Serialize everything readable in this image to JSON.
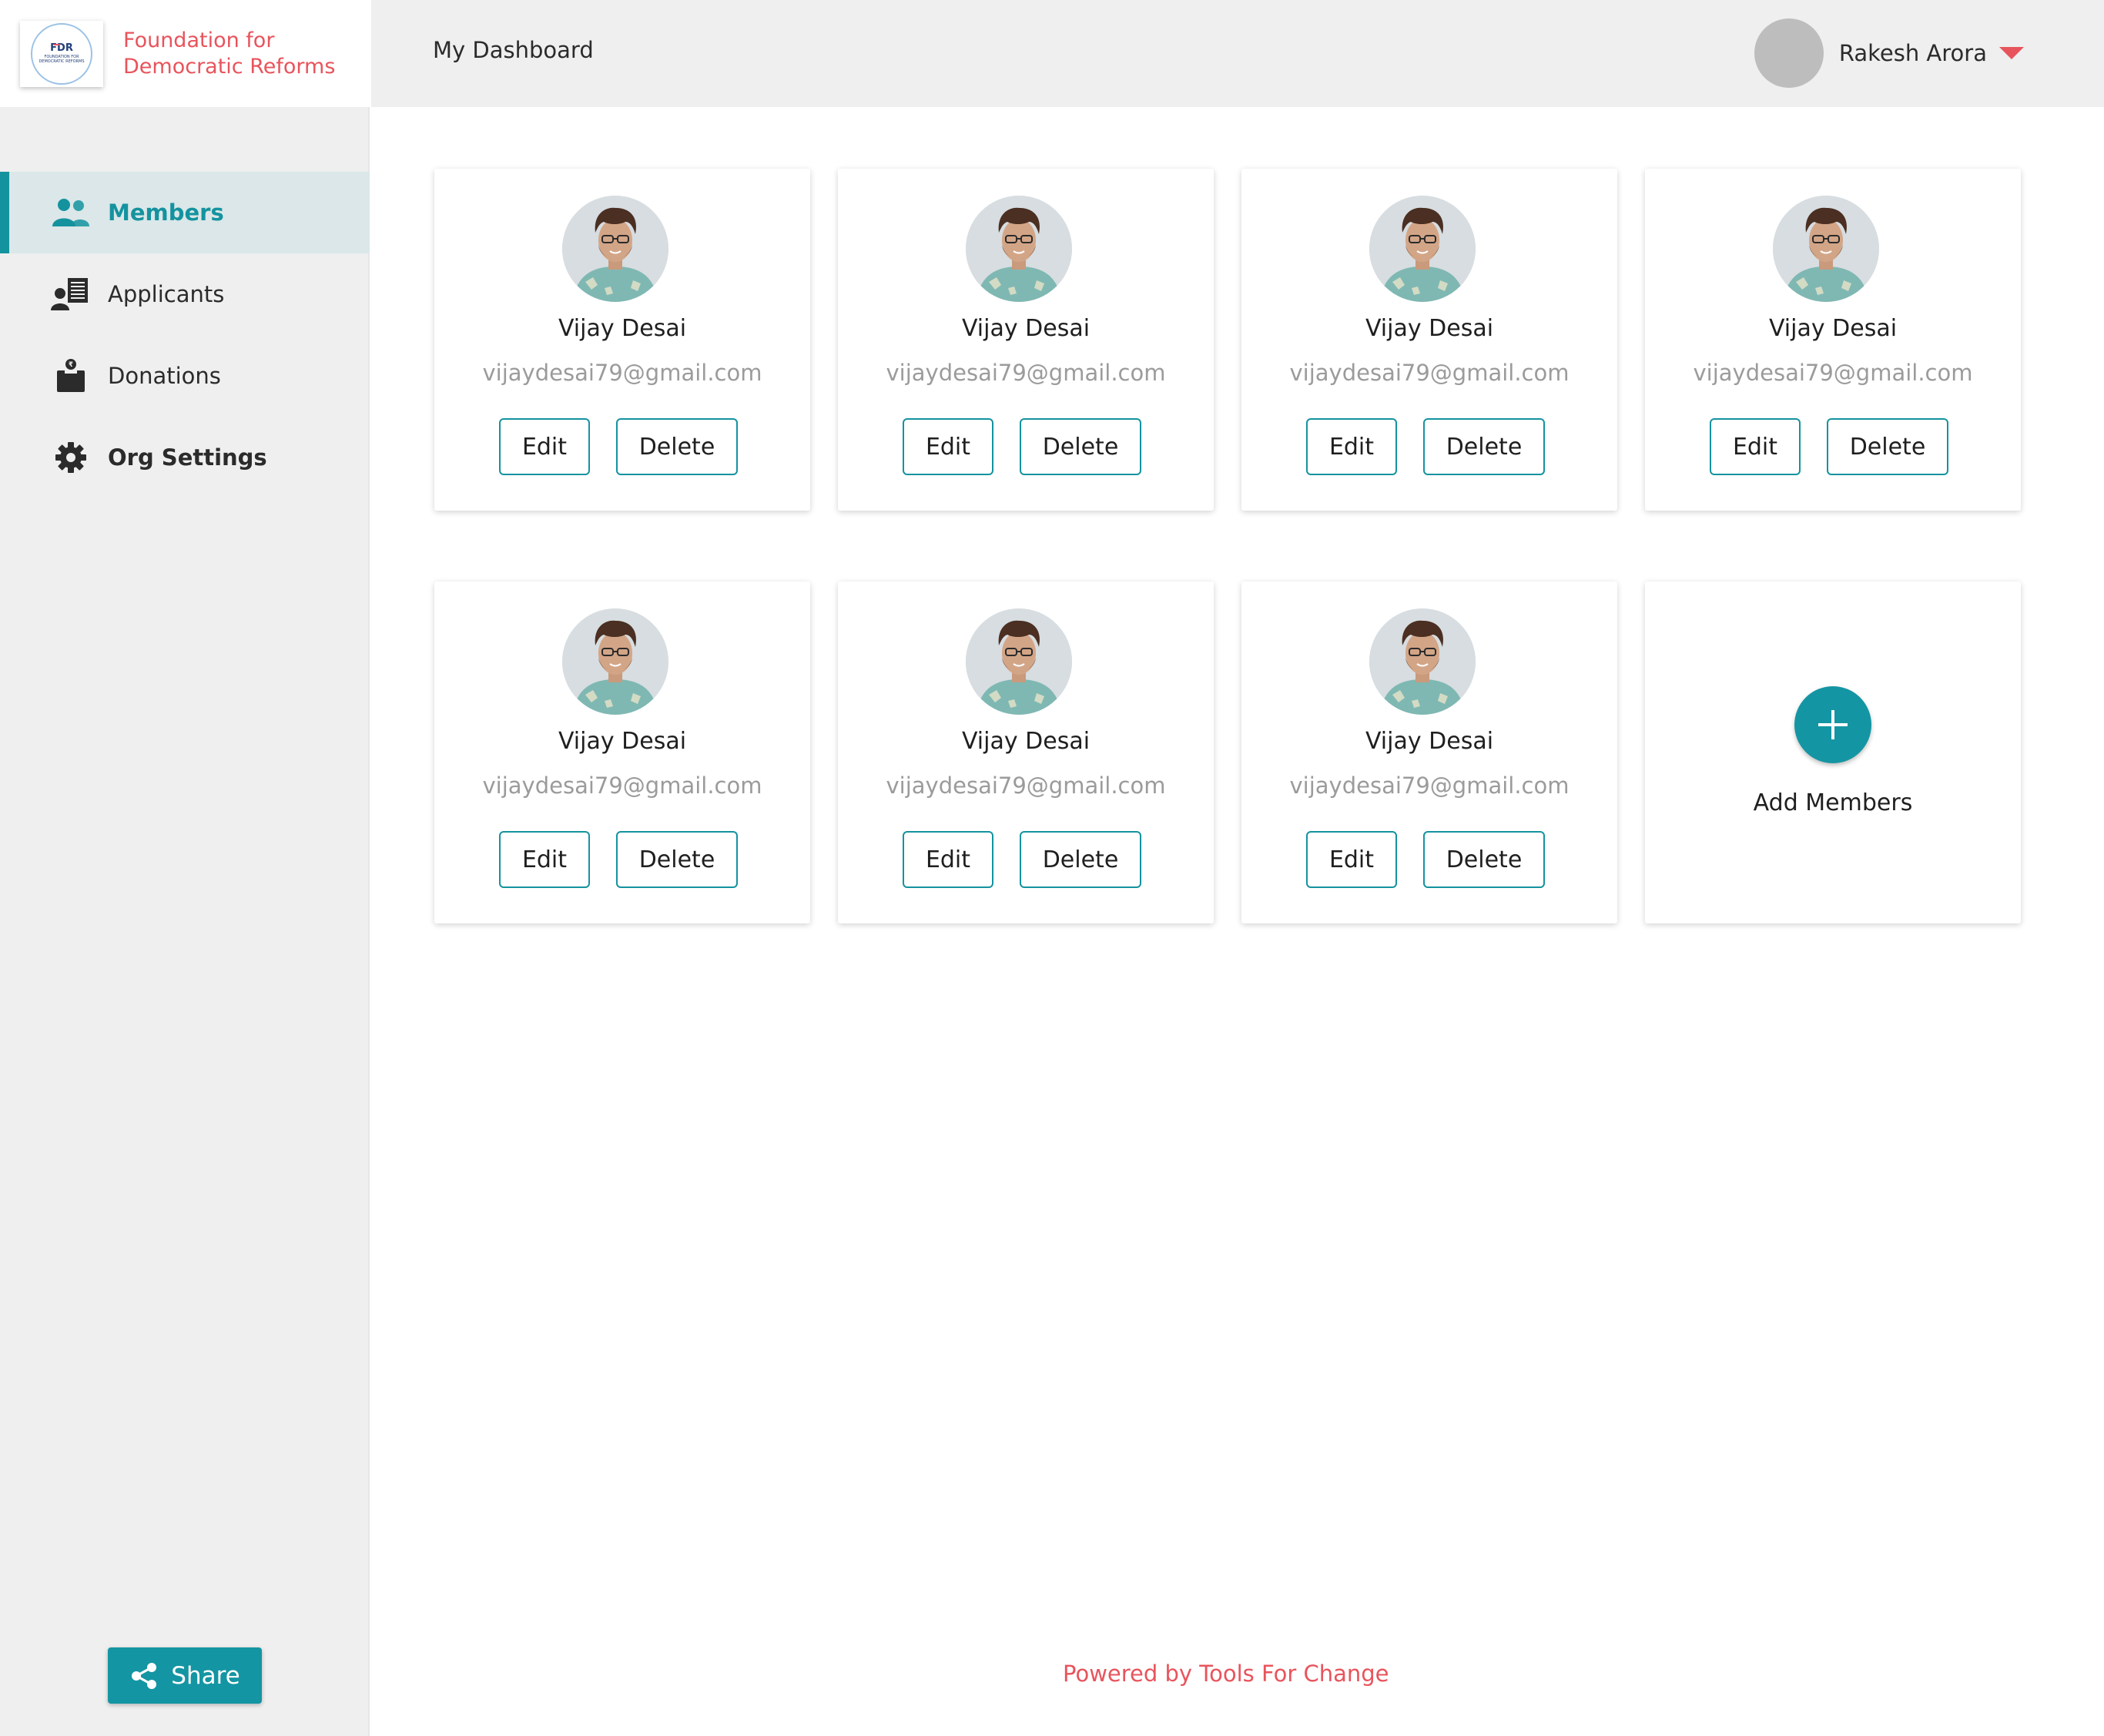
{
  "brand": {
    "name_line1": "Foundation for",
    "name_line2": "Democratic Reforms",
    "logo_text": "FDR",
    "logo_sub1": "FOUNDATION FOR",
    "logo_sub2": "DEMOCRATIC REFORMS"
  },
  "header": {
    "title": "My Dashboard",
    "user_name": "Rakesh Arora"
  },
  "sidebar": {
    "items": [
      {
        "label": "Members",
        "icon": "members-icon",
        "active": true
      },
      {
        "label": "Applicants",
        "icon": "applicants-icon"
      },
      {
        "label": "Donations",
        "icon": "donations-icon"
      },
      {
        "label": "Org Settings",
        "icon": "gear-icon"
      }
    ],
    "share_label": "Share"
  },
  "members": [
    {
      "name": "Vijay Desai",
      "email": "vijaydesai79@gmail.com"
    },
    {
      "name": "Vijay Desai",
      "email": "vijaydesai79@gmail.com"
    },
    {
      "name": "Vijay Desai",
      "email": "vijaydesai79@gmail.com"
    },
    {
      "name": "Vijay Desai",
      "email": "vijaydesai79@gmail.com"
    },
    {
      "name": "Vijay Desai",
      "email": "vijaydesai79@gmail.com"
    },
    {
      "name": "Vijay Desai",
      "email": "vijaydesai79@gmail.com"
    },
    {
      "name": "Vijay Desai",
      "email": "vijaydesai79@gmail.com"
    }
  ],
  "card_actions": {
    "edit_label": "Edit",
    "delete_label": "Delete"
  },
  "add_members_label": "Add Members",
  "footer": {
    "text": "Powered by Tools For Change"
  },
  "colors": {
    "accent": "#1495a3",
    "brand_red": "#e8545c",
    "sidebar_bg": "#efefef",
    "active_bg": "#dbe7e8"
  }
}
